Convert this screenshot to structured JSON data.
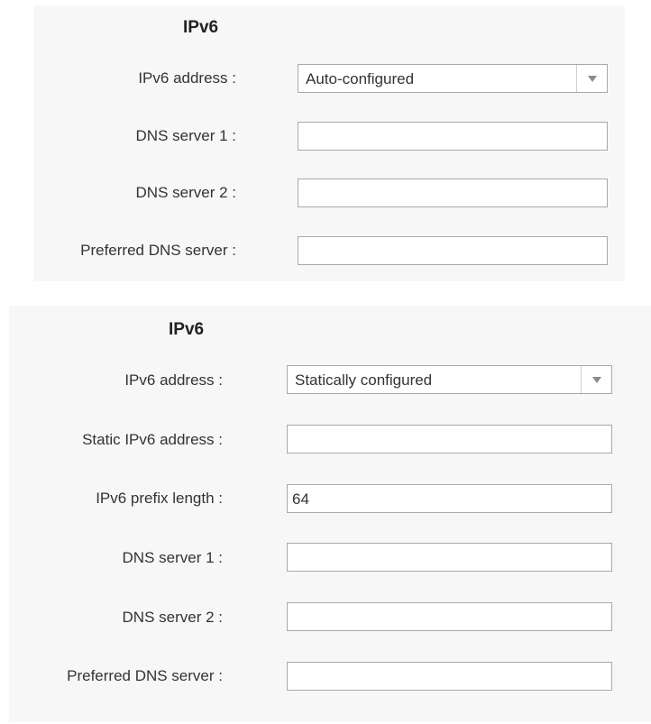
{
  "panel1": {
    "title": "IPv6",
    "ipv6_address_label": "IPv6 address :",
    "ipv6_address_value": "Auto-configured",
    "dns1_label": "DNS server 1 :",
    "dns1_value": "",
    "dns2_label": "DNS server 2 :",
    "dns2_value": "",
    "preferred_dns_label": "Preferred DNS server :",
    "preferred_dns_value": ""
  },
  "panel2": {
    "title": "IPv6",
    "ipv6_address_label": "IPv6 address :",
    "ipv6_address_value": "Statically configured",
    "static_ipv6_label": "Static IPv6 address :",
    "static_ipv6_value": "",
    "prefix_length_label": "IPv6 prefix length :",
    "prefix_length_value": "64",
    "dns1_label": "DNS server 1 :",
    "dns1_value": "",
    "dns2_label": "DNS server 2 :",
    "dns2_value": "",
    "preferred_dns_label": "Preferred DNS server :",
    "preferred_dns_value": ""
  },
  "icons": {
    "dropdown": "chevron-down-icon"
  },
  "colors": {
    "panel_bg": "#f7f7f7",
    "field_border": "#a9a9a9",
    "text": "#333333"
  }
}
